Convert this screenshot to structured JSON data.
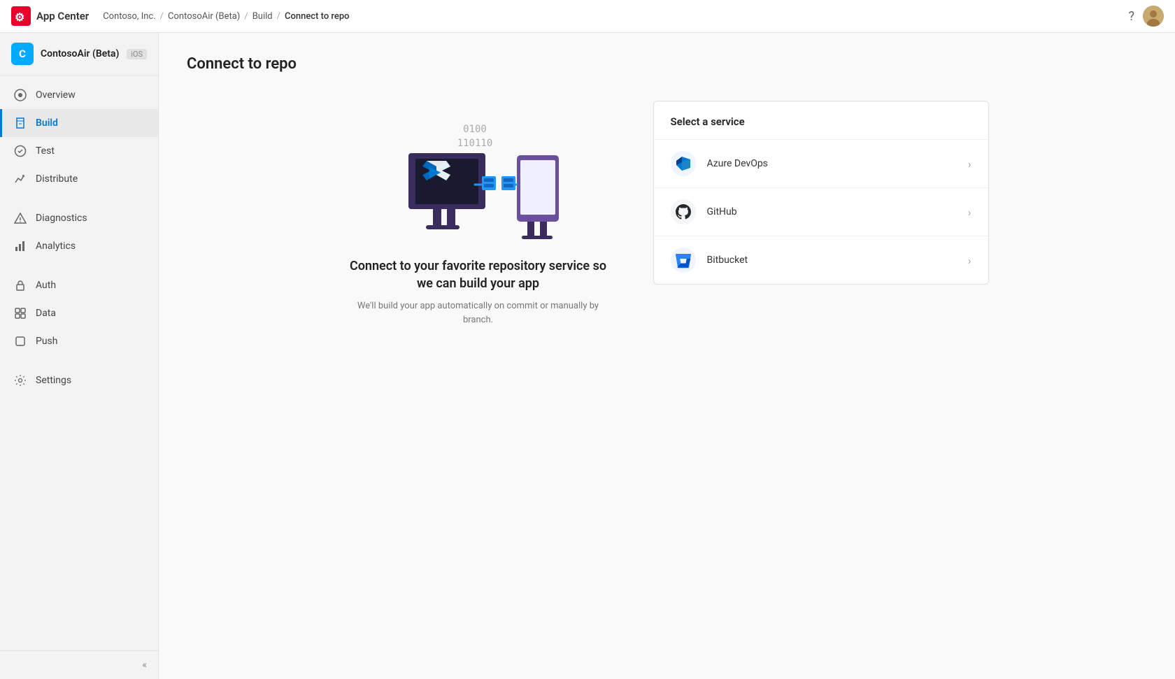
{
  "topbar": {
    "app_title": "App Center",
    "breadcrumb": [
      {
        "label": "Contoso, Inc.",
        "link": true
      },
      {
        "label": "ContosoAir (Beta)",
        "link": true
      },
      {
        "label": "Build",
        "link": true
      },
      {
        "label": "Connect to repo",
        "link": false
      }
    ],
    "help_icon": "?",
    "avatar_initials": ""
  },
  "sidebar": {
    "app_name": "ContosoAir (Beta)",
    "app_platform": "iOS",
    "app_avatar_letter": "C",
    "nav_items": [
      {
        "id": "overview",
        "label": "Overview",
        "icon": "overview"
      },
      {
        "id": "build",
        "label": "Build",
        "icon": "build",
        "active": true
      },
      {
        "id": "test",
        "label": "Test",
        "icon": "test"
      },
      {
        "id": "distribute",
        "label": "Distribute",
        "icon": "distribute"
      },
      {
        "id": "diagnostics",
        "label": "Diagnostics",
        "icon": "diagnostics"
      },
      {
        "id": "analytics",
        "label": "Analytics",
        "icon": "analytics"
      },
      {
        "id": "auth",
        "label": "Auth",
        "icon": "auth"
      },
      {
        "id": "data",
        "label": "Data",
        "icon": "data"
      },
      {
        "id": "push",
        "label": "Push",
        "icon": "push"
      },
      {
        "id": "settings",
        "label": "Settings",
        "icon": "settings"
      }
    ],
    "collapse_label": "«"
  },
  "page": {
    "title": "Connect to repo",
    "connect_title": "Connect to your favorite repository service so we can build your app",
    "connect_subtitle": "We'll build your app automatically on commit or manually by branch.",
    "binary_text_1": "0100",
    "binary_text_2": "110110"
  },
  "services": {
    "section_title": "Select a service",
    "items": [
      {
        "id": "azure-devops",
        "name": "Azure DevOps",
        "icon": "azure-devops"
      },
      {
        "id": "github",
        "name": "GitHub",
        "icon": "github"
      },
      {
        "id": "bitbucket",
        "name": "Bitbucket",
        "icon": "bitbucket"
      }
    ]
  }
}
